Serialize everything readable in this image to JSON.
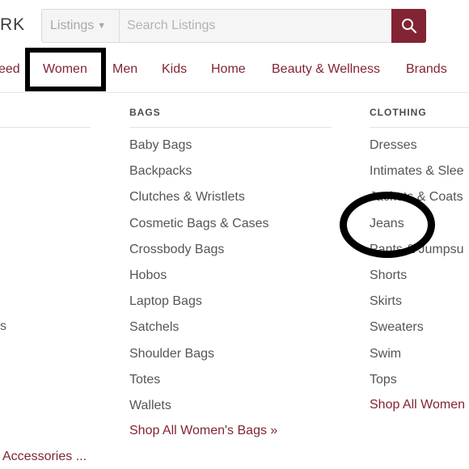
{
  "header": {
    "logo_fragment": "RK",
    "search": {
      "scope_label": "Listings",
      "placeholder": "Search Listings"
    }
  },
  "nav": {
    "items": [
      "eed",
      "Women",
      "Men",
      "Kids",
      "Home",
      "Beauty & Wellness",
      "Brands"
    ],
    "active": "Women"
  },
  "dropdown": {
    "left_fragments": [
      "s",
      "Accessories ..."
    ],
    "bags": {
      "heading": "BAGS",
      "items": [
        "Baby Bags",
        "Backpacks",
        "Clutches & Wristlets",
        "Cosmetic Bags & Cases",
        "Crossbody Bags",
        "Hobos",
        "Laptop Bags",
        "Satchels",
        "Shoulder Bags",
        "Totes",
        "Wallets"
      ],
      "shop_all": "Shop All Women's Bags »"
    },
    "clothing": {
      "heading": "CLOTHING",
      "items": [
        "Dresses",
        "Intimates & Slee",
        "Jackets & Coats",
        "Jeans",
        "Pants & Jumpsu",
        "Shorts",
        "Skirts",
        "Sweaters",
        "Swim",
        "Tops"
      ],
      "shop_all": "Shop All Women"
    }
  },
  "annotations": {
    "highlight_color": "#000000"
  },
  "colors": {
    "brand": "#822433",
    "text": "#555555"
  }
}
